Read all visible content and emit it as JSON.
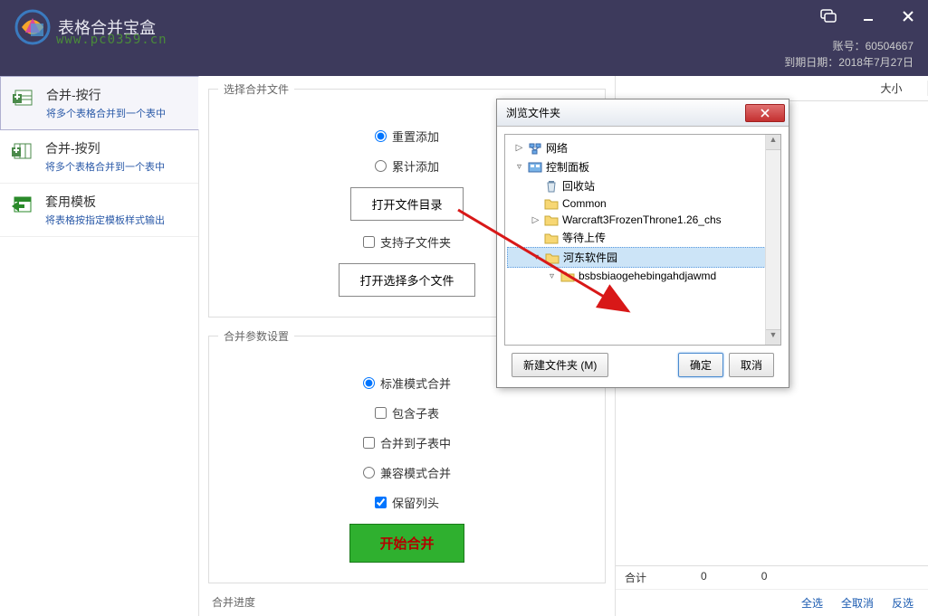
{
  "app": {
    "title": "表格合并宝盒",
    "watermark_url": "www.pc0359.cn",
    "account_label": "账号：",
    "account_no": "60504667",
    "expire_label": "到期日期：",
    "expire_date": "2018年7月27日"
  },
  "sidebar": [
    {
      "title": "合并-按行",
      "desc": "将多个表格合并到一个表中",
      "icon": "merge-rows"
    },
    {
      "title": "合并-按列",
      "desc": "将多个表格合并到一个表中",
      "icon": "merge-cols"
    },
    {
      "title": "套用模板",
      "desc": "将表格按指定模板样式输出",
      "icon": "template"
    }
  ],
  "panels": {
    "select_files": "选择合并文件",
    "params": "合并参数设置",
    "progress": "合并进度"
  },
  "controls": {
    "reset_add": "重置添加",
    "accum_add": "累计添加",
    "open_dir": "打开文件目录",
    "support_sub": "支持子文件夹",
    "open_multi": "打开选择多个文件",
    "std_mode": "标准模式合并",
    "inc_sub": "包含子表",
    "to_sub": "合并到子表中",
    "compat_mode": "兼容模式合并",
    "keep_header": "保留列头",
    "start": "开始合并"
  },
  "right": {
    "header_size": "大小",
    "total_label": "合计",
    "total_v1": "0",
    "total_v2": "0",
    "select_all": "全选",
    "deselect_all": "全取消",
    "invert": "反选"
  },
  "dialog": {
    "title": "浏览文件夹",
    "tree": [
      {
        "indent": 0,
        "expander": "▷",
        "icon": "network",
        "label": "网络"
      },
      {
        "indent": 0,
        "expander": "▿",
        "icon": "control",
        "label": "控制面板"
      },
      {
        "indent": 1,
        "expander": "",
        "icon": "recycle",
        "label": "回收站"
      },
      {
        "indent": 1,
        "expander": "",
        "icon": "folder",
        "label": "Common"
      },
      {
        "indent": 1,
        "expander": "▷",
        "icon": "folder",
        "label": "Warcraft3FrozenThrone1.26_chs"
      },
      {
        "indent": 1,
        "expander": "",
        "icon": "folder",
        "label": "等待上传"
      },
      {
        "indent": 1,
        "expander": "▿",
        "icon": "folder",
        "label": "河东软件园",
        "selected": true
      },
      {
        "indent": 2,
        "expander": "▿",
        "icon": "folder",
        "label": "bsbsbiaogehebingahdjawmd"
      }
    ],
    "new_folder": "新建文件夹 (M)",
    "ok": "确定",
    "cancel": "取消"
  }
}
